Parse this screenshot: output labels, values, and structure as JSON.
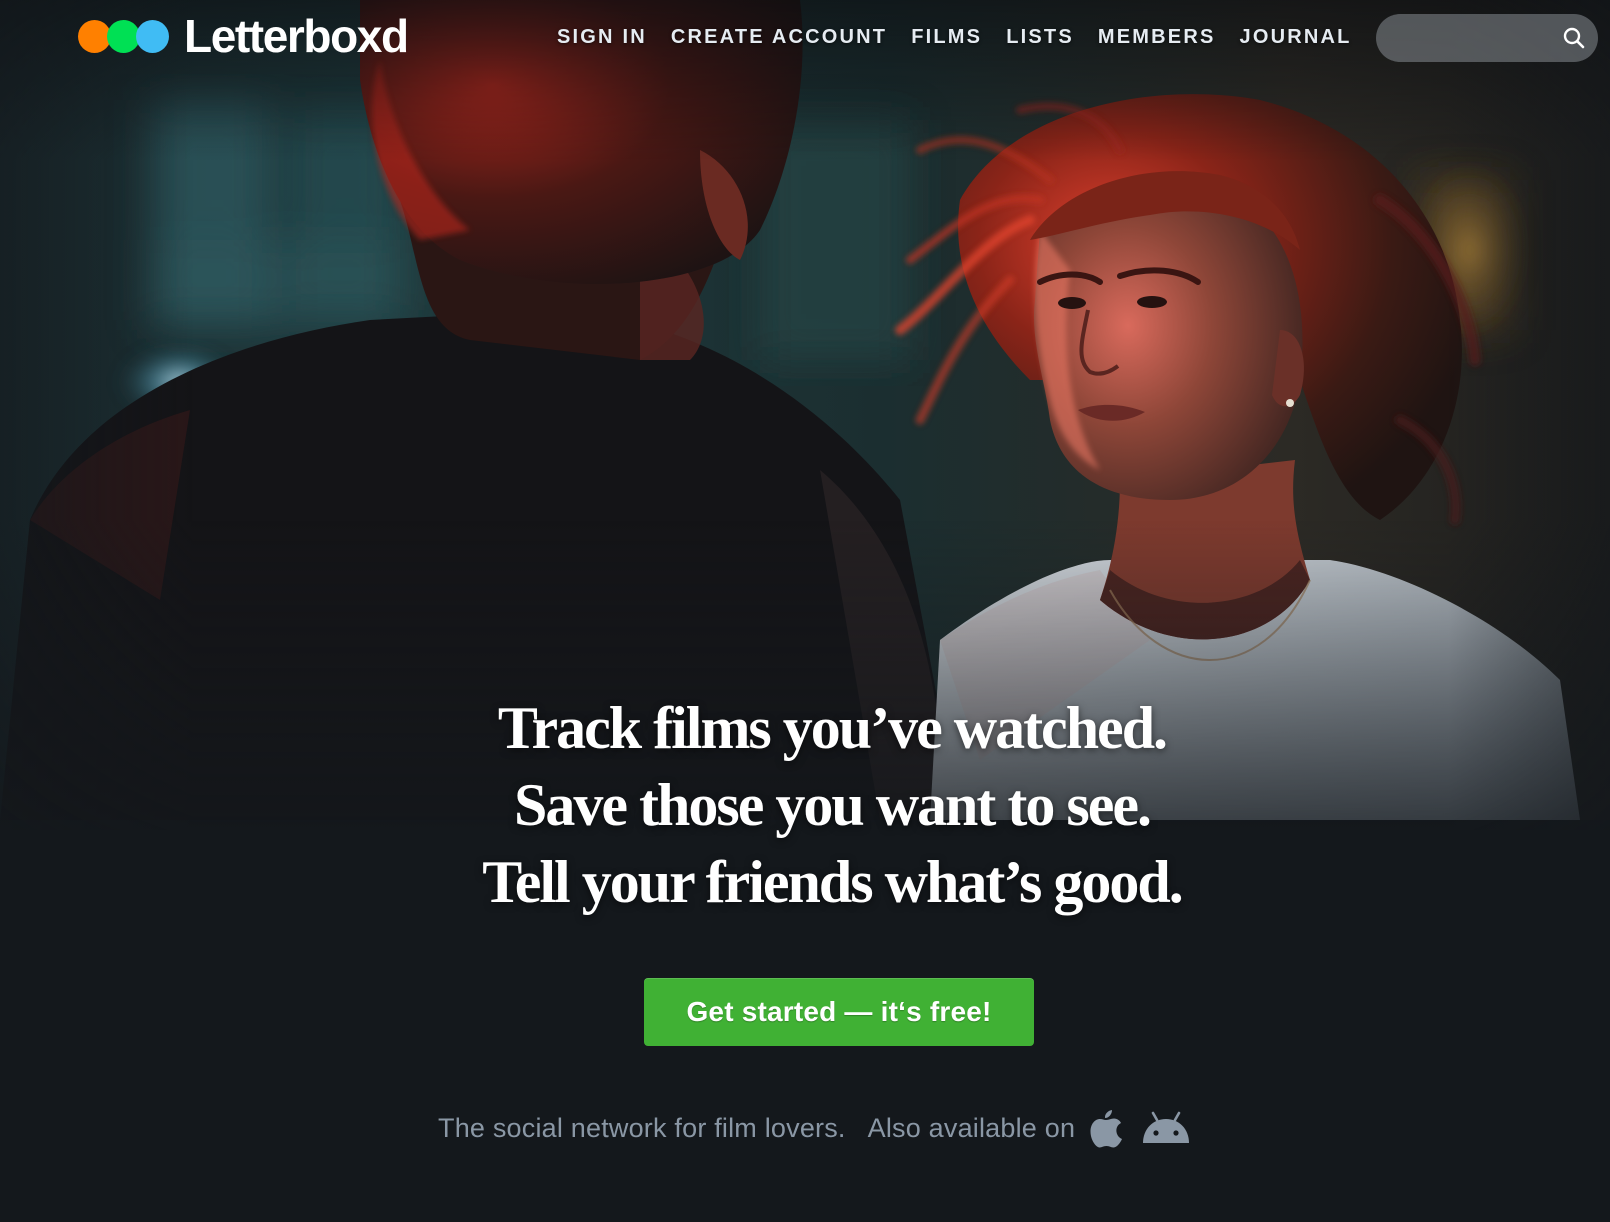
{
  "brand": {
    "name": "Letterboxd",
    "dot_colors": [
      "#ff8000",
      "#00e054",
      "#40bcf4"
    ]
  },
  "nav": {
    "items": [
      {
        "label": "SIGN IN"
      },
      {
        "label": "CREATE ACCOUNT"
      },
      {
        "label": "FILMS"
      },
      {
        "label": "LISTS"
      },
      {
        "label": "MEMBERS"
      },
      {
        "label": "JOURNAL"
      }
    ]
  },
  "search": {
    "value": "",
    "icon": "search-icon"
  },
  "hero": {
    "headline": [
      "Track films you’ve watched.",
      "Save those you want to see.",
      "Tell your friends what’s good."
    ],
    "cta_label": "Get started — it‘s free!",
    "tagline": "The social network for film lovers.",
    "also_available": "Also available on",
    "platforms": [
      "apple-icon",
      "android-icon"
    ]
  },
  "colors": {
    "background": "#14181c",
    "cta": "#40b134",
    "muted_text": "#8a97a5"
  }
}
